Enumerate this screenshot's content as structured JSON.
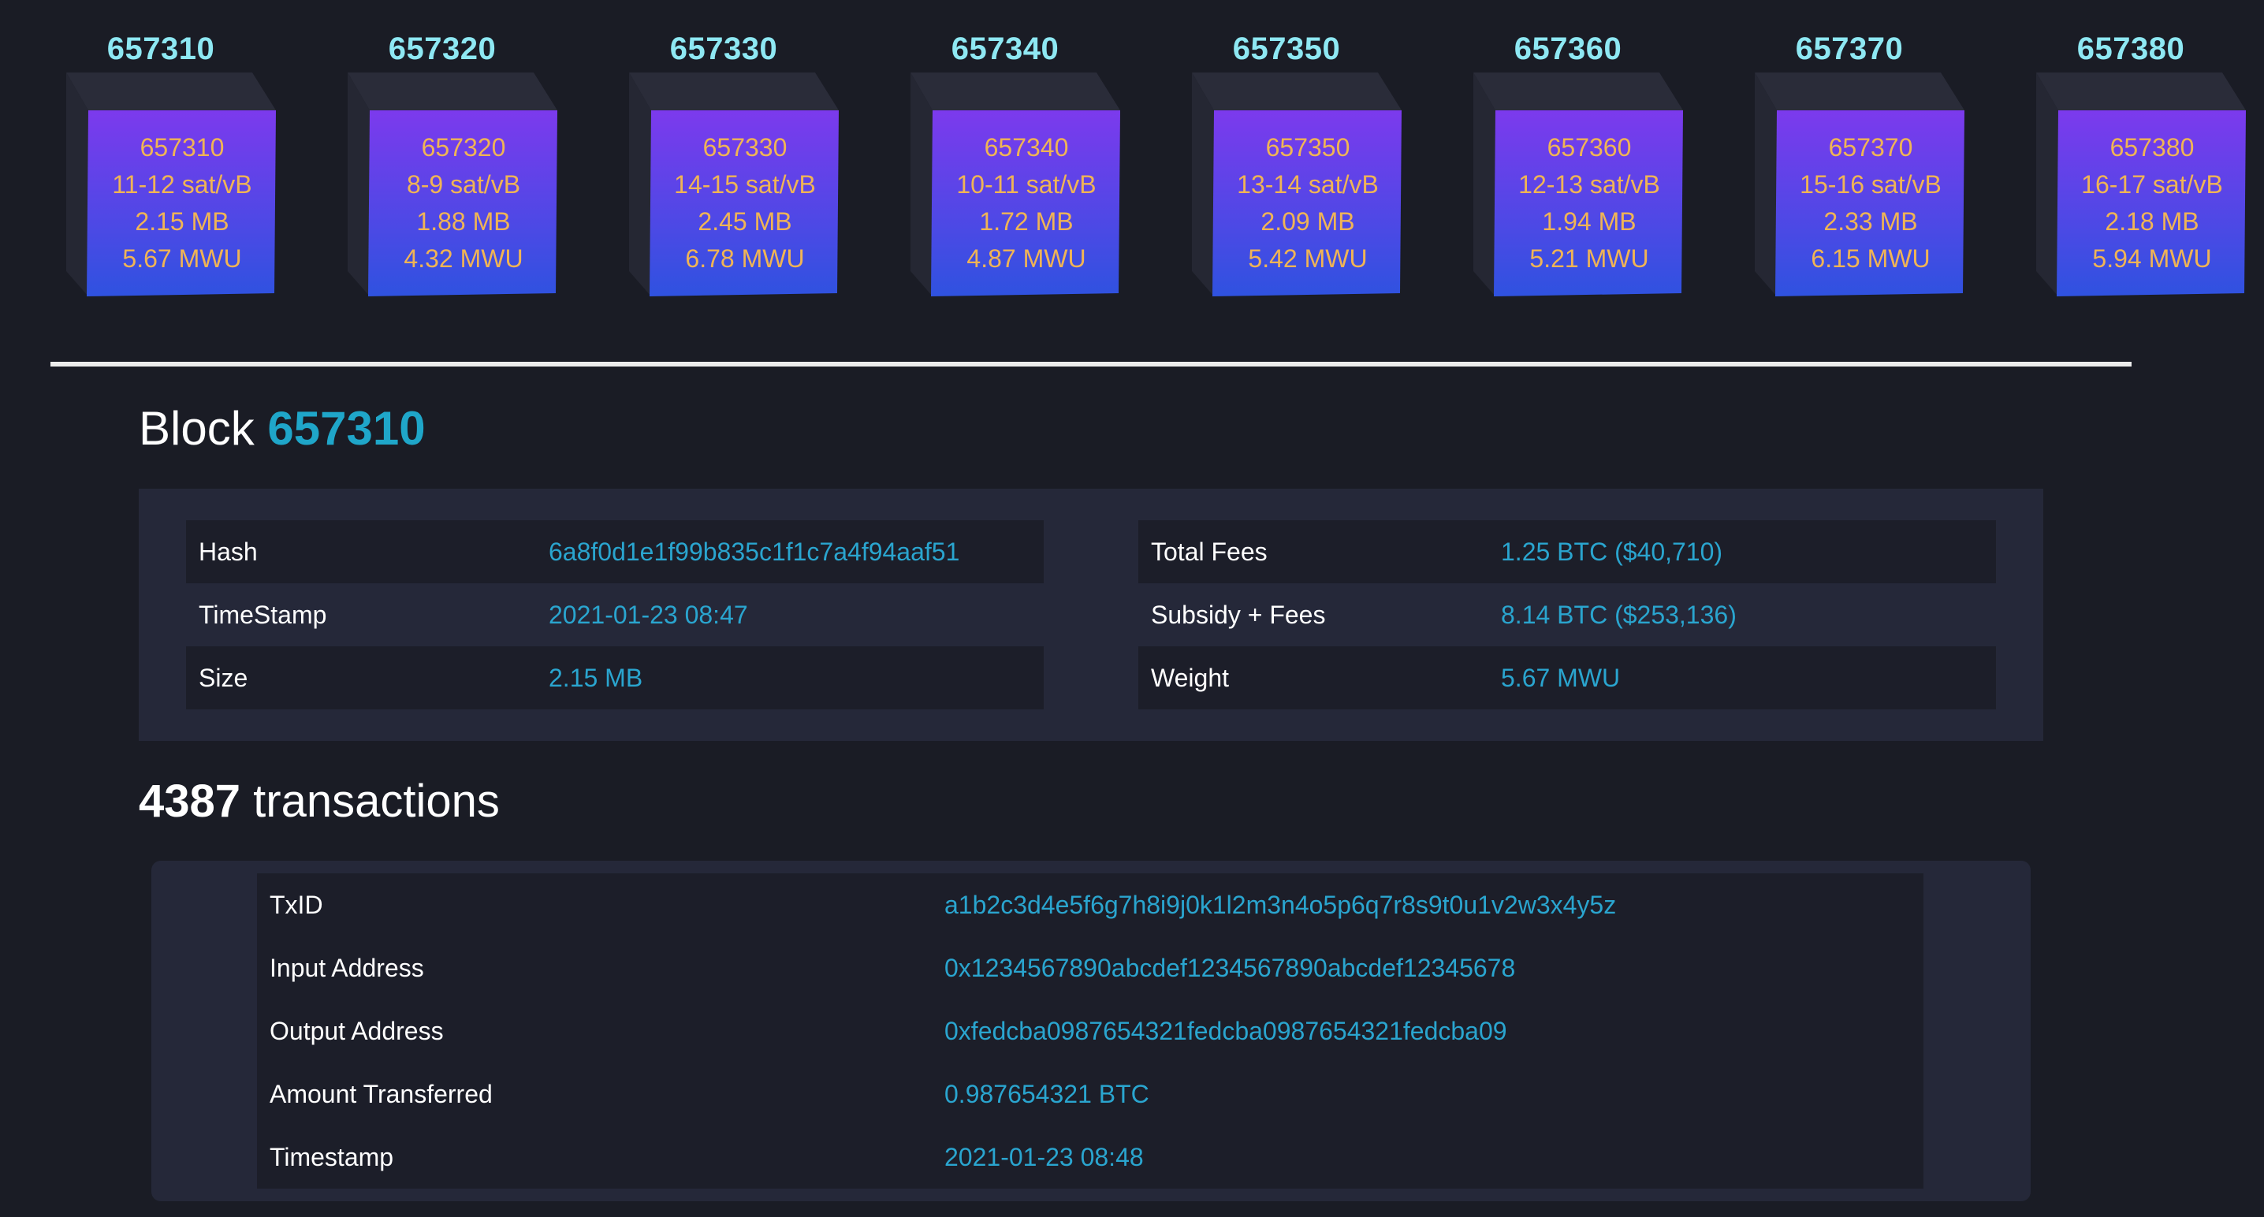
{
  "blocks": [
    {
      "height": "657310",
      "fee_range": "11-12 sat/vB",
      "size": "2.15 MB",
      "weight": "5.67 MWU"
    },
    {
      "height": "657320",
      "fee_range": "8-9 sat/vB",
      "size": "1.88 MB",
      "weight": "4.32 MWU"
    },
    {
      "height": "657330",
      "fee_range": "14-15 sat/vB",
      "size": "2.45 MB",
      "weight": "6.78 MWU"
    },
    {
      "height": "657340",
      "fee_range": "10-11 sat/vB",
      "size": "1.72 MB",
      "weight": "4.87 MWU"
    },
    {
      "height": "657350",
      "fee_range": "13-14 sat/vB",
      "size": "2.09 MB",
      "weight": "5.42 MWU"
    },
    {
      "height": "657360",
      "fee_range": "12-13 sat/vB",
      "size": "1.94 MB",
      "weight": "5.21 MWU"
    },
    {
      "height": "657370",
      "fee_range": "15-16 sat/vB",
      "size": "2.33 MB",
      "weight": "6.15 MWU"
    },
    {
      "height": "657380",
      "fee_range": "16-17 sat/vB",
      "size": "2.18 MB",
      "weight": "5.94 MWU"
    }
  ],
  "block_detail": {
    "heading_prefix": "Block",
    "heading_number": "657310",
    "left": [
      {
        "label": "Hash",
        "value": "6a8f0d1e1f99b835c1f1c7a4f94aaf51"
      },
      {
        "label": "TimeStamp",
        "value": "2021-01-23 08:47"
      },
      {
        "label": "Size",
        "value": "2.15 MB"
      }
    ],
    "right": [
      {
        "label": "Total Fees",
        "value": "1.25 BTC ($40,710)"
      },
      {
        "label": "Subsidy + Fees",
        "value": "8.14 BTC ($253,136)"
      },
      {
        "label": "Weight",
        "value": "5.67 MWU"
      }
    ]
  },
  "transactions": {
    "count": "4387",
    "count_suffix": "transactions",
    "rows": [
      {
        "label": "TxID",
        "value": "a1b2c3d4e5f6g7h8i9j0k1l2m3n4o5p6q7r8s9t0u1v2w3x4y5z"
      },
      {
        "label": "Input Address",
        "value": "0x1234567890abcdef1234567890abcdef12345678"
      },
      {
        "label": "Output Address",
        "value": "0xfedcba0987654321fedcba0987654321fedcba09"
      },
      {
        "label": "Amount Transferred",
        "value": "0.987654321 BTC"
      },
      {
        "label": "Timestamp",
        "value": "2021-01-23 08:48"
      }
    ]
  },
  "colors": {
    "background": "#1a1c25",
    "panel": "#252839",
    "row_dark": "#1c1e29",
    "accent_value": "#2aa5cf",
    "block_title": "#8ee8f3",
    "cube_text": "#f0b455",
    "cube_gradient_top": "#7c3aed",
    "cube_gradient_bottom": "#2f52e0"
  }
}
